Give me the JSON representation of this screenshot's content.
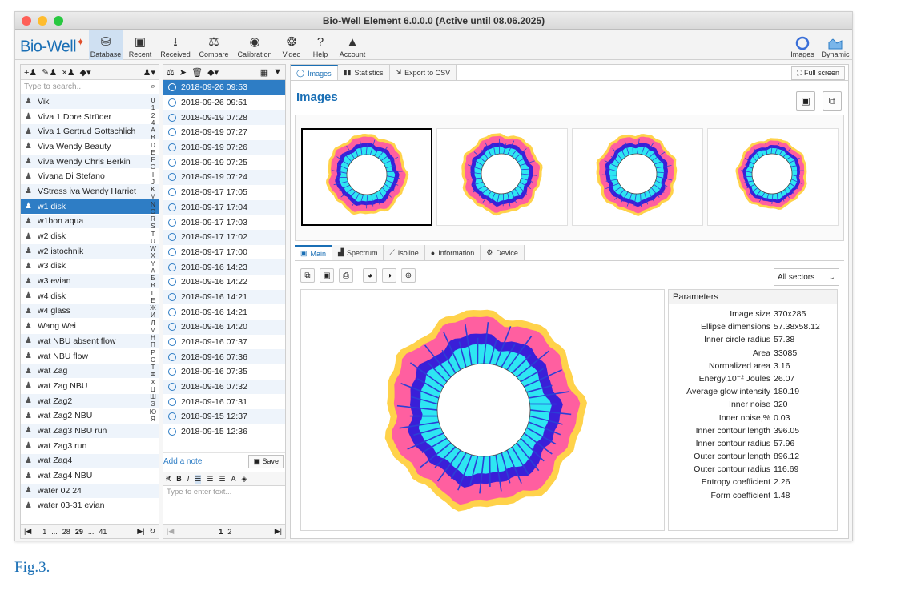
{
  "window": {
    "title": "Bio-Well Element 6.0.0.0 (Active until 08.06.2025)"
  },
  "logo": {
    "text": "Bio-Well"
  },
  "toolbar": [
    {
      "label": "Database",
      "icon": "database-icon",
      "glyph": "⛁"
    },
    {
      "label": "Recent",
      "icon": "recent-icon",
      "glyph": "▣"
    },
    {
      "label": "Received",
      "icon": "received-icon",
      "glyph": "⭳"
    },
    {
      "label": "Compare",
      "icon": "compare-icon",
      "glyph": "⚖"
    },
    {
      "label": "Calibration",
      "icon": "calibration-icon",
      "glyph": "◉"
    },
    {
      "label": "Video",
      "icon": "video-icon",
      "glyph": "❂"
    },
    {
      "label": "Help",
      "icon": "help-icon",
      "glyph": "?"
    },
    {
      "label": "Account",
      "icon": "account-icon",
      "glyph": "▲"
    }
  ],
  "toolbar_right": [
    {
      "label": "Images",
      "icon": "images-ring-icon"
    },
    {
      "label": "Dynamic",
      "icon": "dynamic-chart-icon"
    }
  ],
  "people": {
    "search_placeholder": "Type to search...",
    "items": [
      "Viki",
      "Viva 1 Dore Strüder",
      "Viva 1 Gertrud Gottschlich",
      "Viva Wendy Beauty",
      "Viva Wendy Chris Berkin",
      "Vivana Di Stefano",
      "VStress iva Wendy Harriet",
      "w1 disk",
      "w1bon  aqua",
      "w2 disk",
      "w2 istochnik",
      "w3 disk",
      "w3 evian",
      "w4 disk",
      "w4 glass",
      "Wang Wei",
      "wat NBU absent  flow",
      "wat NBU flow",
      "wat Zag",
      "wat Zag NBU",
      "wat Zag2",
      "wat Zag2 NBU",
      "wat Zag3 NBU run",
      "wat Zag3 run",
      "wat Zag4",
      "wat Zag4 NBU",
      "water 02 24",
      "water 03-31 evian"
    ],
    "selected_index": 7,
    "alphabet": [
      "0",
      "1",
      "2",
      "4",
      "A",
      "B",
      "D",
      "E",
      "F",
      "G",
      "I",
      "J",
      "K",
      "M",
      "N",
      "O",
      "R",
      "S",
      "T",
      "U",
      "W",
      "X",
      "Y",
      "А",
      "Б",
      "В",
      "Г",
      "Е",
      "Ж",
      "И",
      "Л",
      "М",
      "Н",
      "П",
      "Р",
      "С",
      "Т",
      "Ф",
      "Х",
      "Ц",
      "Ш",
      "Э",
      "Ю",
      "Я"
    ],
    "pager": {
      "first": "1",
      "dots1": "...",
      "p28": "28",
      "p29": "29",
      "dots2": "...",
      "last": "41"
    }
  },
  "sessions": {
    "items": [
      "2018-09-26 09:53",
      "2018-09-26 09:51",
      "2018-09-19 07:28",
      "2018-09-19 07:27",
      "2018-09-19 07:26",
      "2018-09-19 07:25",
      "2018-09-19 07:24",
      "2018-09-17 17:05",
      "2018-09-17 17:04",
      "2018-09-17 17:03",
      "2018-09-17 17:02",
      "2018-09-17 17:00",
      "2018-09-16 14:23",
      "2018-09-16 14:22",
      "2018-09-16 14:21",
      "2018-09-16 14:21",
      "2018-09-16 14:20",
      "2018-09-16 07:37",
      "2018-09-16 07:36",
      "2018-09-16 07:35",
      "2018-09-16 07:32",
      "2018-09-16 07:31",
      "2018-09-15 12:37",
      "2018-09-15 12:36"
    ],
    "selected_index": 0,
    "add_note": "Add a note",
    "save": "Save",
    "note_placeholder": "Type to enter text...",
    "pager": {
      "p1": "1",
      "p2": "2"
    }
  },
  "main_tabs": [
    {
      "label": "Images",
      "icon": "ring-icon"
    },
    {
      "label": "Statistics",
      "icon": "bar-chart-icon"
    },
    {
      "label": "Export to CSV",
      "icon": "export-icon"
    }
  ],
  "full_screen": "Full screen",
  "section_title": "Images",
  "sub_tabs": [
    {
      "label": "Main",
      "icon": "image-icon"
    },
    {
      "label": "Spectrum",
      "icon": "spectrum-icon"
    },
    {
      "label": "Isoline",
      "icon": "isoline-icon"
    },
    {
      "label": "Information",
      "icon": "info-icon"
    },
    {
      "label": "Device",
      "icon": "gear-icon"
    }
  ],
  "sector_select": "All sectors",
  "parameters": {
    "title": "Parameters",
    "rows": [
      {
        "label": "Image size",
        "value": "370x285"
      },
      {
        "label": "Ellipse dimensions",
        "value": "57.38x58.12"
      },
      {
        "label": "Inner circle radius",
        "value": "57.38"
      },
      {
        "label": "Area",
        "value": "33085"
      },
      {
        "label": "Normalized area",
        "value": "3.16"
      },
      {
        "label": "Energy,10⁻² Joules",
        "value": "26.07"
      },
      {
        "label": "Average glow intensity",
        "value": "180.19"
      },
      {
        "label": "Inner noise",
        "value": "320"
      },
      {
        "label": "Inner noise,%",
        "value": "0.03"
      },
      {
        "label": "Inner contour length",
        "value": "396.05"
      },
      {
        "label": "Inner contour radius",
        "value": "57.96"
      },
      {
        "label": "Outer contour length",
        "value": "896.12"
      },
      {
        "label": "Outer contour radius",
        "value": "116.69"
      },
      {
        "label": "Entropy coefficient",
        "value": "2.26"
      },
      {
        "label": "Form coefficient",
        "value": "1.48"
      }
    ]
  },
  "caption": "Fig.3.",
  "colors": {
    "accent": "#2e7dc5",
    "glow_inner": "#2ee6f2",
    "glow_mid": "#3a1fd8",
    "glow_outer": "#ff5fa0",
    "glow_edge": "#ffd24a"
  }
}
